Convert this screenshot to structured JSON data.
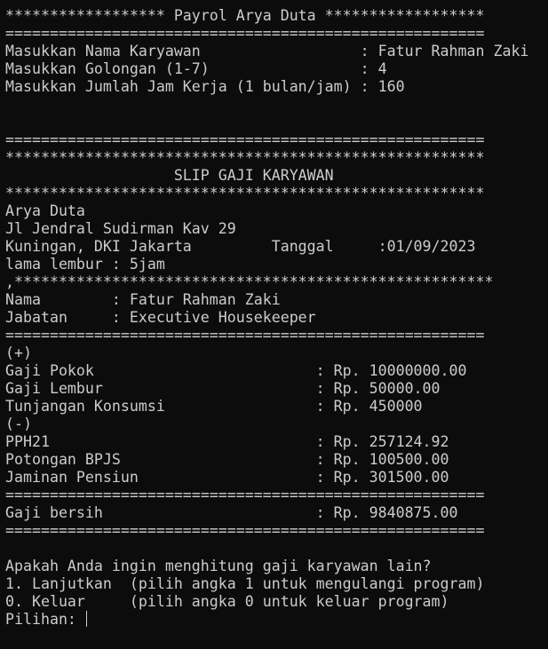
{
  "terminal": {
    "lines": [
      "****************** Payrol Arya Duta ******************",
      "======================================================",
      "Masukkan Nama Karyawan                  : Fatur Rahman Zaki",
      "Masukkan Golongan (1-7)                 : 4",
      "Masukkan Jumlah Jam Kerja (1 bulan/jam) : 160",
      "",
      "",
      "======================================================",
      "******************************************************",
      "                   SLIP GAJI KARYAWAN",
      "******************************************************",
      "Arya Duta",
      "Jl Jendral Sudirman Kav 29",
      "Kuningan, DKI Jakarta         Tanggal     :01/09/2023",
      "lama lembur : 5jam",
      ",******************************************************",
      "Nama        : Fatur Rahman Zaki",
      "Jabatan     : Executive Housekeeper",
      "======================================================",
      "(+)",
      "Gaji Pokok                         : Rp. 10000000.00",
      "Gaji Lembur                        : Rp. 50000.00",
      "Tunjangan Konsumsi                 : Rp. 450000",
      "(-)",
      "PPH21                              : Rp. 257124.92",
      "Potongan BPJS                      : Rp. 100500.00",
      "Jaminan Pensiun                    : Rp. 301500.00",
      "======================================================",
      "Gaji bersih                        : Rp. 9840875.00",
      "======================================================",
      "",
      "Apakah Anda ingin menghitung gaji karyawan lain?",
      "1. Lanjutkan  (pilih angka 1 untuk mengulangi program)",
      "0. Keluar     (pilih angka 0 untuk keluar program)"
    ],
    "prompt": "Pilihan: "
  }
}
